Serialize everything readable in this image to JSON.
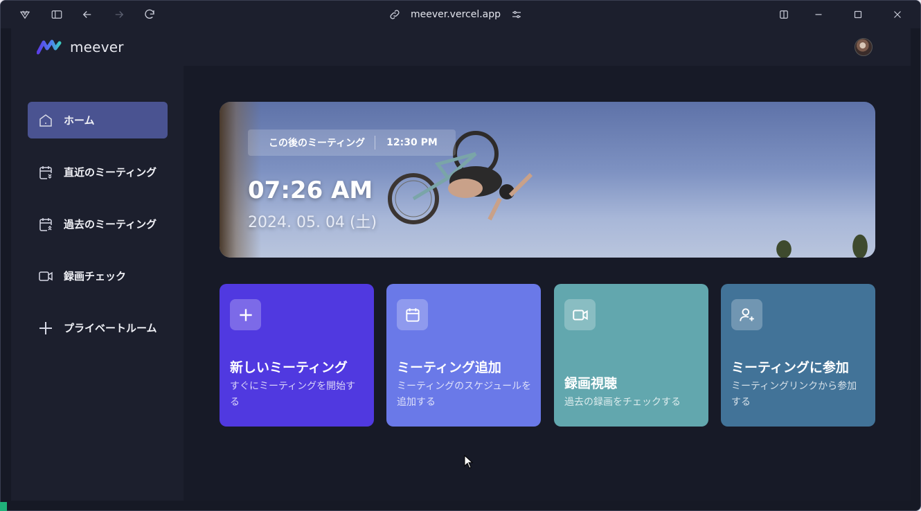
{
  "browser": {
    "url": "meever.vercel.app"
  },
  "app": {
    "name": "meever"
  },
  "sidebar": {
    "items": [
      {
        "label": "ホーム",
        "icon": "home-icon",
        "active": true
      },
      {
        "label": "直近のミーティング",
        "icon": "calendar-forward-icon"
      },
      {
        "label": "過去のミーティング",
        "icon": "calendar-back-icon"
      },
      {
        "label": "録画チェック",
        "icon": "video-icon"
      },
      {
        "label": "プライベートルーム",
        "icon": "plus-icon"
      }
    ]
  },
  "hero": {
    "next_meeting_label": "この後のミーティング",
    "next_meeting_time": "12:30 PM",
    "clock": "07:26 AM",
    "date": "2024. 05. 04 (土)"
  },
  "cards": [
    {
      "title": "新しいミーティング",
      "desc": "すぐにミーティングを開始する",
      "icon": "plus-icon",
      "color": "#5039e0"
    },
    {
      "title": "ミーティング追加",
      "desc": "ミーティングのスケジュールを追加する",
      "icon": "calendar-icon",
      "color": "#6a79e8"
    },
    {
      "title": "録画視聴",
      "desc": "過去の録画をチェックする",
      "icon": "video-icon",
      "color": "#62a7ae"
    },
    {
      "title": "ミーティングに参加",
      "desc": "ミーティングリンクから参加する",
      "icon": "user-plus-icon",
      "color": "#427398"
    }
  ]
}
